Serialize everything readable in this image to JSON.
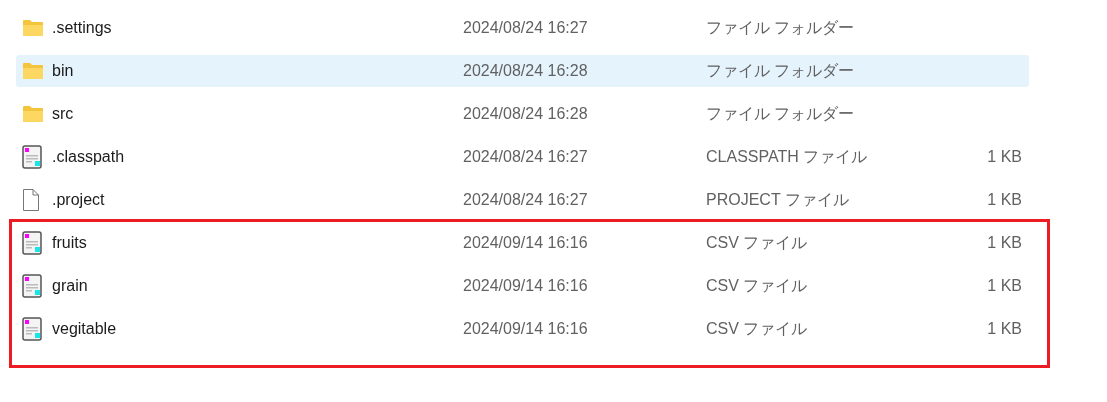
{
  "files": [
    {
      "kind": "folder",
      "name": ".settings",
      "modified": "2024/08/24 16:27",
      "type": "ファイル フォルダー",
      "selected": false,
      "annotated": false
    },
    {
      "kind": "folder",
      "name": "bin",
      "modified": "2024/08/24 16:28",
      "type": "ファイル フォルダー",
      "selected": true,
      "annotated": false
    },
    {
      "kind": "folder",
      "name": "src",
      "modified": "2024/08/24 16:28",
      "type": "ファイル フォルダー",
      "selected": false,
      "annotated": false
    },
    {
      "kind": "text",
      "name": ".classpath",
      "modified": "2024/08/24 16:27",
      "type": "CLASSPATH ファイル",
      "size": "1 KB",
      "selected": false,
      "annotated": false
    },
    {
      "kind": "blank",
      "name": ".project",
      "modified": "2024/08/24 16:27",
      "type": "PROJECT ファイル",
      "size": "1 KB",
      "selected": false,
      "annotated": false
    },
    {
      "kind": "text",
      "name": "fruits",
      "modified": "2024/09/14 16:16",
      "type": "CSV ファイル",
      "size": "1 KB",
      "selected": false,
      "annotated": true
    },
    {
      "kind": "text",
      "name": "grain",
      "modified": "2024/09/14 16:16",
      "type": "CSV ファイル",
      "size": "1 KB",
      "selected": false,
      "annotated": true
    },
    {
      "kind": "text",
      "name": "vegitable",
      "modified": "2024/09/14 16:16",
      "type": "CSV ファイル",
      "size": "1 KB",
      "selected": false,
      "annotated": true
    }
  ]
}
